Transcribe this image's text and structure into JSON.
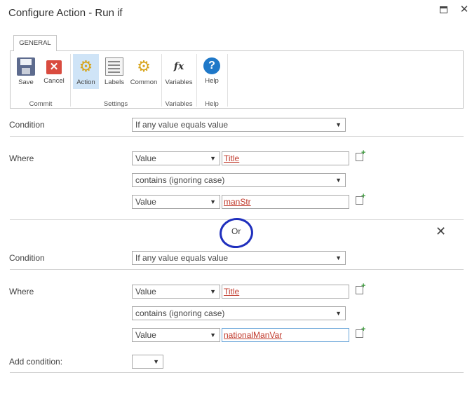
{
  "window": {
    "title": "Configure Action - Run if"
  },
  "ribbon": {
    "tab": "GENERAL",
    "buttons": {
      "save": "Save",
      "cancel": "Cancel",
      "action": "Action",
      "labels": "Labels",
      "common": "Common",
      "variables": "Variables",
      "help": "Help"
    },
    "groups": {
      "commit": "Commit",
      "settings": "Settings",
      "variables": "Variables",
      "help": "Help"
    }
  },
  "conditions": [
    {
      "condition_label": "Condition",
      "condition_value": "If any value equals value",
      "where_label": "Where",
      "left_type": "Value",
      "left_value": "Title",
      "operator": "contains (ignoring case)",
      "right_type": "Value",
      "right_value": "manStr"
    },
    {
      "condition_label": "Condition",
      "condition_value": "If any value equals value",
      "where_label": "Where",
      "left_type": "Value",
      "left_value": "Title",
      "operator": "contains (ignoring case)",
      "right_type": "Value",
      "right_value": "nationalManVar"
    }
  ],
  "joiner": "Or",
  "add_condition": {
    "label": "Add condition:",
    "value": ""
  },
  "icons": {
    "arrow": "▼",
    "close": "✕",
    "remove": "✕",
    "maximize": "maximize-icon"
  },
  "colors": {
    "annotation": "#1f2fbd",
    "link_text": "#c0392b"
  }
}
